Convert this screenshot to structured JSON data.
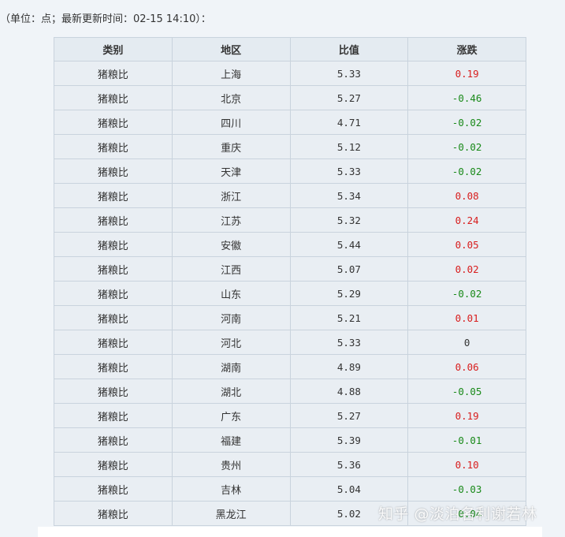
{
  "note": "（单位：点；最新更新时间：02-15 14:10）：",
  "table": {
    "headers": [
      "类别",
      "地区",
      "比值",
      "涨跌"
    ],
    "rows": [
      {
        "category": "猪粮比",
        "region": "上海",
        "ratio": "5.33",
        "change": "0.19",
        "trend": "up"
      },
      {
        "category": "猪粮比",
        "region": "北京",
        "ratio": "5.27",
        "change": "-0.46",
        "trend": "down"
      },
      {
        "category": "猪粮比",
        "region": "四川",
        "ratio": "4.71",
        "change": "-0.02",
        "trend": "down"
      },
      {
        "category": "猪粮比",
        "region": "重庆",
        "ratio": "5.12",
        "change": "-0.02",
        "trend": "down"
      },
      {
        "category": "猪粮比",
        "region": "天津",
        "ratio": "5.33",
        "change": "-0.02",
        "trend": "down"
      },
      {
        "category": "猪粮比",
        "region": "浙江",
        "ratio": "5.34",
        "change": "0.08",
        "trend": "up"
      },
      {
        "category": "猪粮比",
        "region": "江苏",
        "ratio": "5.32",
        "change": "0.24",
        "trend": "up"
      },
      {
        "category": "猪粮比",
        "region": "安徽",
        "ratio": "5.44",
        "change": "0.05",
        "trend": "up"
      },
      {
        "category": "猪粮比",
        "region": "江西",
        "ratio": "5.07",
        "change": "0.02",
        "trend": "up"
      },
      {
        "category": "猪粮比",
        "region": "山东",
        "ratio": "5.29",
        "change": "-0.02",
        "trend": "down"
      },
      {
        "category": "猪粮比",
        "region": "河南",
        "ratio": "5.21",
        "change": "0.01",
        "trend": "up"
      },
      {
        "category": "猪粮比",
        "region": "河北",
        "ratio": "5.33",
        "change": "0",
        "trend": "flat"
      },
      {
        "category": "猪粮比",
        "region": "湖南",
        "ratio": "4.89",
        "change": "0.06",
        "trend": "up"
      },
      {
        "category": "猪粮比",
        "region": "湖北",
        "ratio": "4.88",
        "change": "-0.05",
        "trend": "down"
      },
      {
        "category": "猪粮比",
        "region": "广东",
        "ratio": "5.27",
        "change": "0.19",
        "trend": "up"
      },
      {
        "category": "猪粮比",
        "region": "福建",
        "ratio": "5.39",
        "change": "-0.01",
        "trend": "down"
      },
      {
        "category": "猪粮比",
        "region": "贵州",
        "ratio": "5.36",
        "change": "0.10",
        "trend": "up"
      },
      {
        "category": "猪粮比",
        "region": "吉林",
        "ratio": "5.04",
        "change": "-0.03",
        "trend": "down"
      },
      {
        "category": "猪粮比",
        "region": "黑龙江",
        "ratio": "5.02",
        "change": "-0.04",
        "trend": "down"
      }
    ]
  },
  "watermark": "知乎 @淡泊名利谢若林",
  "colors": {
    "up": "#d81e1e",
    "down": "#1a8a1a",
    "flat": "#333333",
    "header_bg": "#e4ebf1",
    "cell_bg": "#e9eef3",
    "border": "#c9d3dd"
  }
}
